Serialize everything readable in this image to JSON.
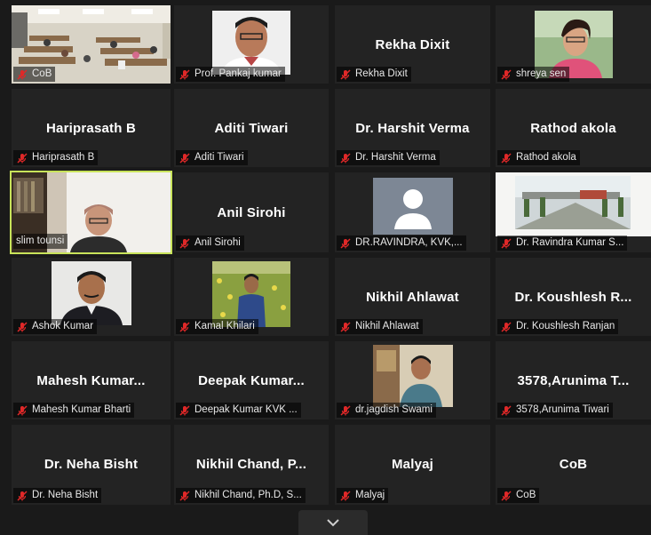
{
  "participants": [
    {
      "id": "p1",
      "center": "",
      "label": "CoB",
      "video": "classroom"
    },
    {
      "id": "p2",
      "center": "",
      "label": "Prof. Pankaj kumar",
      "video": "portrait-man-white-shirt"
    },
    {
      "id": "p3",
      "center": "Rekha Dixit",
      "label": "Rekha Dixit",
      "video": ""
    },
    {
      "id": "p4",
      "center": "",
      "label": "shreya sen",
      "video": "portrait-woman"
    },
    {
      "id": "p5",
      "center": "Hariprasath B",
      "label": "Hariprasath B",
      "video": ""
    },
    {
      "id": "p6",
      "center": "Aditi Tiwari",
      "label": "Aditi Tiwari",
      "video": ""
    },
    {
      "id": "p7",
      "center": "Dr. Harshit Verma",
      "label": "Dr. Harshit Verma",
      "video": ""
    },
    {
      "id": "p8",
      "center": "Rathod akola",
      "label": "Rathod akola",
      "video": ""
    },
    {
      "id": "p9",
      "center": "",
      "label": "slim tounsi",
      "video": "webcam-room"
    },
    {
      "id": "p10",
      "center": "Anil Sirohi",
      "label": "Anil Sirohi",
      "video": ""
    },
    {
      "id": "p11",
      "center": "",
      "label": "DR.RAVINDRA, KVK,...",
      "video": "avatar-placeholder"
    },
    {
      "id": "p12",
      "center": "",
      "label": "Dr. Ravindra Kumar S...",
      "video": "landscape"
    },
    {
      "id": "p13",
      "center": "",
      "label": "Ashok Kumar",
      "video": "portrait-man-dark-shirt"
    },
    {
      "id": "p14",
      "center": "",
      "label": "Kamal Khilari",
      "video": "portrait-man-field"
    },
    {
      "id": "p15",
      "center": "Nikhil Ahlawat",
      "label": "Nikhil Ahlawat",
      "video": ""
    },
    {
      "id": "p16",
      "center": "Dr. Koushlesh R...",
      "label": "Dr. Koushlesh Ranjan",
      "video": ""
    },
    {
      "id": "p17",
      "center": "Mahesh Kumar...",
      "label": "Mahesh Kumar Bharti",
      "video": ""
    },
    {
      "id": "p18",
      "center": "Deepak Kumar...",
      "label": "Deepak Kumar KVK ...",
      "video": ""
    },
    {
      "id": "p19",
      "center": "",
      "label": "dr.jagdish Swami",
      "video": "portrait-man-room"
    },
    {
      "id": "p20",
      "center": "3578,Arunima T...",
      "label": "3578,Arunima Tiwari",
      "video": ""
    },
    {
      "id": "p21",
      "center": "Dr. Neha Bisht",
      "label": "Dr. Neha Bisht",
      "video": ""
    },
    {
      "id": "p22",
      "center": "Nikhil Chand, P...",
      "label": "Nikhil Chand, Ph.D, S...",
      "video": ""
    },
    {
      "id": "p23",
      "center": "Malyaj",
      "label": "Malyaj",
      "video": ""
    },
    {
      "id": "p24",
      "center": "CoB",
      "label": "CoB",
      "video": ""
    }
  ],
  "active_speaker": "slim tounsi",
  "colors": {
    "background": "#1a1a1a",
    "tile": "#232323",
    "active_border": "#c8e35a",
    "mic_muted": "#e02828"
  },
  "controls": {
    "collapse_icon": "chevron-down-icon"
  }
}
